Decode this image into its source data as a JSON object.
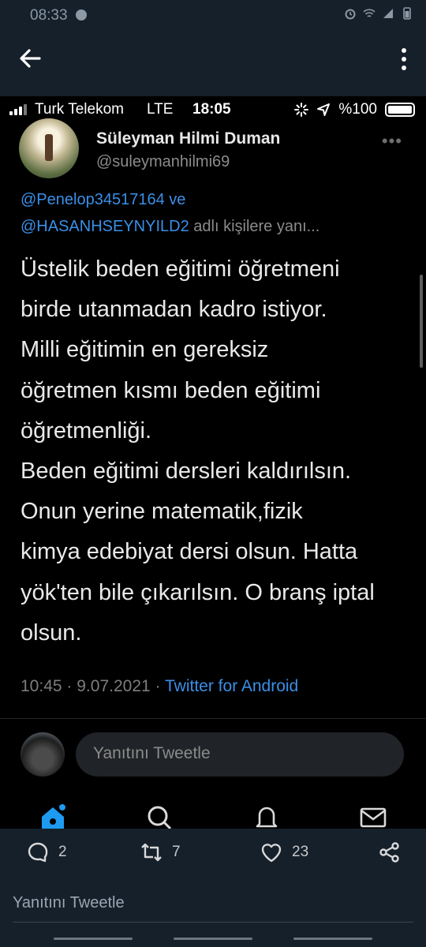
{
  "outer_status": {
    "time": "08:33"
  },
  "icons": {
    "back": "arrow-left-icon",
    "more": "more-vertical-icon",
    "alarm": "alarm-icon",
    "wifi": "wifi-icon",
    "signal": "signal-icon",
    "battery": "battery-icon",
    "home": "home-icon",
    "search": "search-icon",
    "notifications": "bell-icon",
    "messages": "mail-icon",
    "reply": "comment-icon",
    "retweet": "retweet-icon",
    "like": "heart-icon",
    "share": "share-icon"
  },
  "ios_status": {
    "carrier": "Turk Telekom",
    "network": "LTE",
    "time": "18:05",
    "battery": "%100"
  },
  "tweet": {
    "author_name": "Süleyman Hilmi Duman",
    "author_handle": "@suleymanhilmi69",
    "more": "•••",
    "reply_to_1": "@Penelop34517164",
    "reply_to_and": " ve",
    "reply_to_2": "@HASANHSEYNYILD2",
    "reply_to_suffix": " adlı kişilere yanı...",
    "text": "Üstelik beden eğitimi öğretmeni\nbirde utanmadan kadro istiyor.\nMilli eğitimin en gereksiz\nöğretmen kısmı beden eğitimi\nöğretmenliği.\nBeden eğitimi dersleri kaldırılsın.\nOnun yerine matematik,fizik\nkimya edebiyat dersi olsun. Hatta\nyök'ten bile çıkarılsın. O branş iptal\nolsun.",
    "time": "10:45",
    "date": "9.07.2021",
    "separator": "·",
    "source": "Twitter for Android"
  },
  "reply_box": {
    "placeholder": "Yanıtını Tweetle"
  },
  "outer_actions": {
    "replies": "2",
    "retweets": "7",
    "likes": "23"
  },
  "outer_reply": {
    "placeholder": "Yanıtını Tweetle"
  },
  "colors": {
    "outer_bg": "#15202b",
    "inner_bg": "#000000",
    "link": "#3a8fe8",
    "home_icon": "#1d9bf0"
  }
}
